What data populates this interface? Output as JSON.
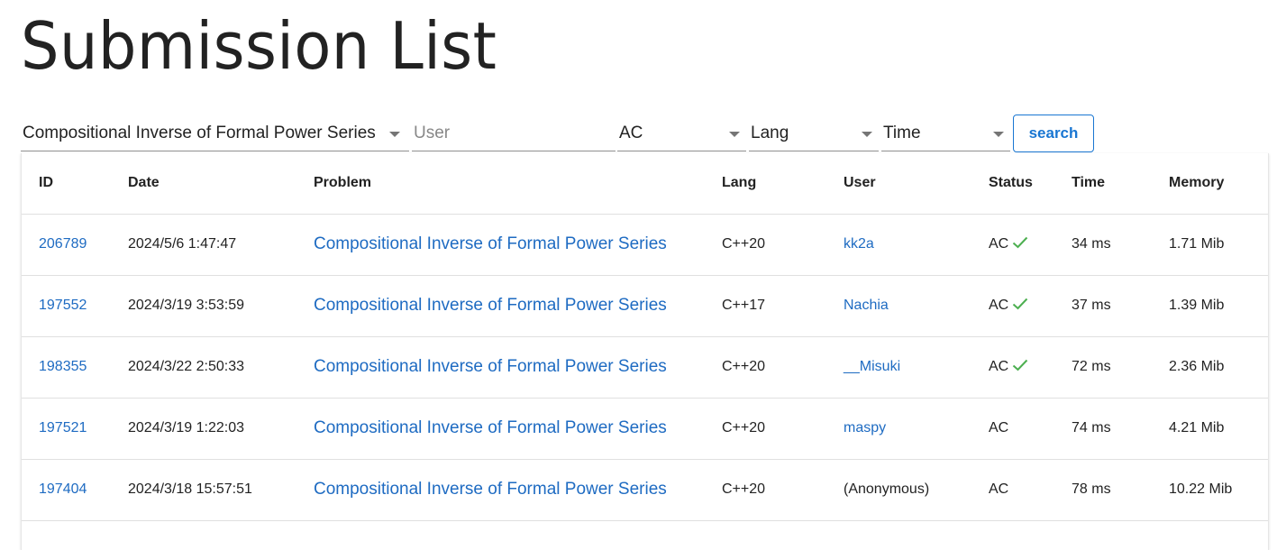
{
  "page_title": "Submission List",
  "filters": {
    "problem": "Compositional Inverse of Formal Power Series",
    "user_placeholder": "User",
    "status": "AC",
    "lang": "Lang",
    "time": "Time",
    "search_label": "search"
  },
  "table": {
    "headers": [
      "ID",
      "Date",
      "Problem",
      "Lang",
      "User",
      "Status",
      "Time",
      "Memory"
    ],
    "rows": [
      {
        "id": "206789",
        "date": "2024/5/6 1:47:47",
        "problem": "Compositional Inverse of Formal Power Series",
        "lang": "C++20",
        "user": "kk2a",
        "status": "AC",
        "verified": true,
        "time": "34 ms",
        "memory": "1.71 Mib"
      },
      {
        "id": "197552",
        "date": "2024/3/19 3:53:59",
        "problem": "Compositional Inverse of Formal Power Series",
        "lang": "C++17",
        "user": "Nachia",
        "status": "AC",
        "verified": true,
        "time": "37 ms",
        "memory": "1.39 Mib"
      },
      {
        "id": "198355",
        "date": "2024/3/22 2:50:33",
        "problem": "Compositional Inverse of Formal Power Series",
        "lang": "C++20",
        "user": "__Misuki",
        "status": "AC",
        "verified": true,
        "time": "72 ms",
        "memory": "2.36 Mib"
      },
      {
        "id": "197521",
        "date": "2024/3/19 1:22:03",
        "problem": "Compositional Inverse of Formal Power Series",
        "lang": "C++20",
        "user": "maspy",
        "status": "AC",
        "verified": false,
        "time": "74 ms",
        "memory": "4.21 Mib"
      },
      {
        "id": "197404",
        "date": "2024/3/18 15:57:51",
        "problem": "Compositional Inverse of Formal Power Series",
        "lang": "C++20",
        "user": "(Anonymous)",
        "status": "AC",
        "verified": false,
        "time": "78 ms",
        "memory": "10.22 Mib",
        "user_is_link": false
      }
    ]
  },
  "colors": {
    "link": "#1e6bc2",
    "check": "#4caf50"
  },
  "icons": {
    "caret": "chevron-down-icon",
    "check": "check-icon"
  }
}
